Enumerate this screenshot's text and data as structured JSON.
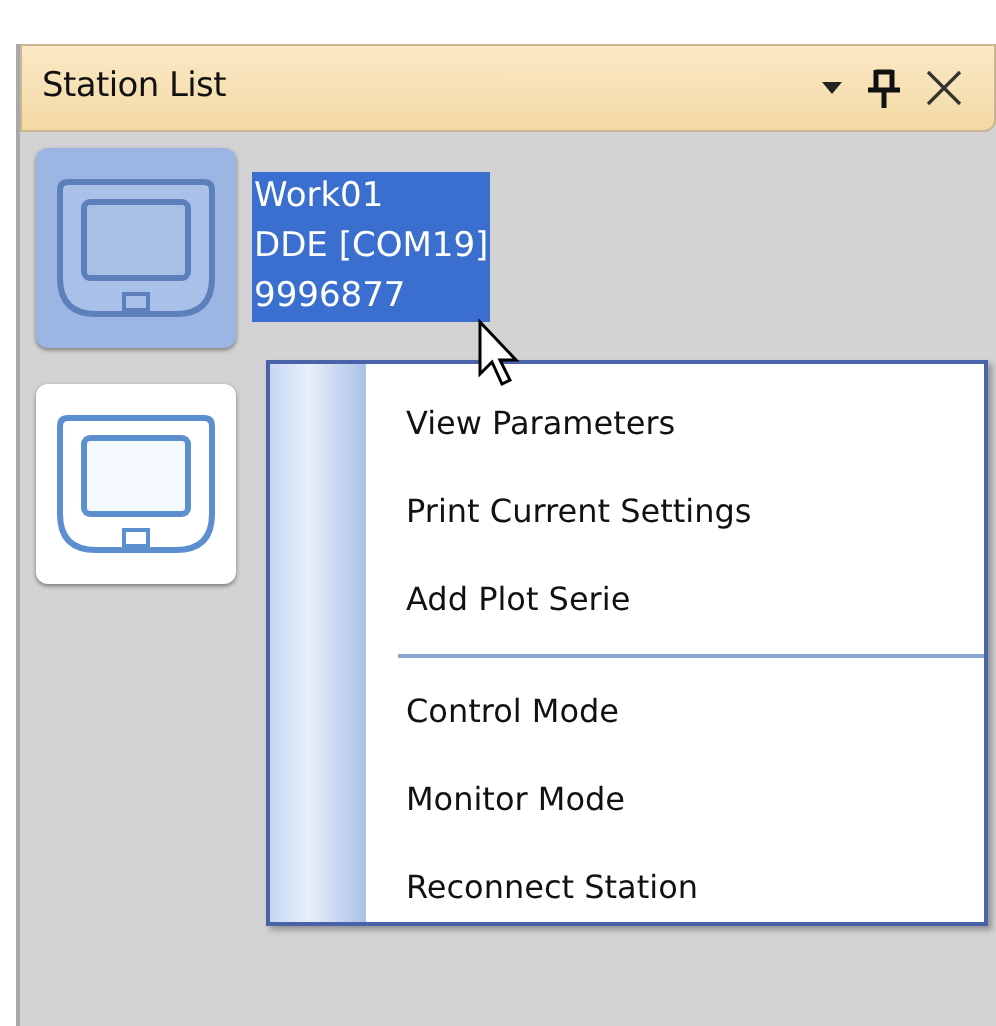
{
  "panel": {
    "title": "Station List"
  },
  "stations": [
    {
      "selected": true,
      "lines": [
        "Work01",
        "DDE [COM19]",
        "9996877"
      ]
    },
    {
      "selected": false
    }
  ],
  "context_menu": [
    {
      "kind": "item",
      "label": "View Parameters"
    },
    {
      "kind": "item",
      "label": "Print Current Settings"
    },
    {
      "kind": "item",
      "label": "Add Plot Serie"
    },
    {
      "kind": "separator"
    },
    {
      "kind": "item",
      "label": "Control Mode"
    },
    {
      "kind": "item",
      "label": "Monitor Mode"
    },
    {
      "kind": "item",
      "label": "Reconnect Station"
    }
  ]
}
